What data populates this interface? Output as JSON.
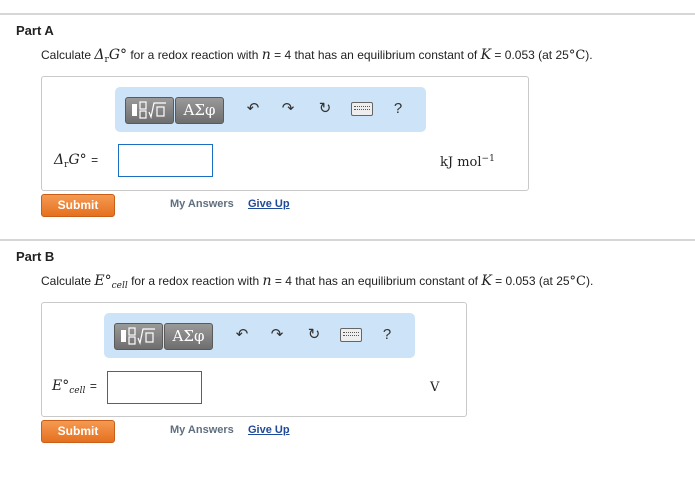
{
  "part_a": {
    "title": "Part A",
    "question": {
      "prefix": "Calculate",
      "symbol": "ΔrG°",
      "middle": "for a redox reaction with",
      "n_var": "n",
      "n_value": "= 4 that has an equilibrium constant of",
      "k_var": "K",
      "k_value": "= 0.053 (at 25",
      "temp_unit": "°C",
      "suffix": ")."
    },
    "lhs": {
      "delta": "Δ",
      "sub": "r",
      "main": "G°",
      "eq": "="
    },
    "unit": {
      "text": "kJ mol",
      "exp": "−1"
    },
    "submit_label": "Submit",
    "my_answers_label": "My Answers",
    "give_up_label": "Give Up",
    "input_value": ""
  },
  "part_b": {
    "title": "Part B",
    "question": {
      "prefix": "Calculate",
      "symbol_main": "E°",
      "symbol_sub": "cell",
      "middle": "for a redox reaction with",
      "n_var": "n",
      "n_value": "= 4 that has an equilibrium constant of",
      "k_var": "K",
      "k_value": "= 0.053 (at 25",
      "temp_unit": "°C",
      "suffix": ")."
    },
    "lhs": {
      "main": "E°",
      "sub": "cell",
      "eq": "="
    },
    "unit": {
      "text": "V"
    },
    "submit_label": "Submit",
    "my_answers_label": "My Answers",
    "give_up_label": "Give Up",
    "input_value": ""
  },
  "toolbar": {
    "templates_icon": "templates-icon",
    "greek_label": "ΑΣφ",
    "undo": "↶",
    "redo": "↷",
    "reset": "↻",
    "keyboard_icon": "keyboard-icon",
    "help": "?"
  }
}
